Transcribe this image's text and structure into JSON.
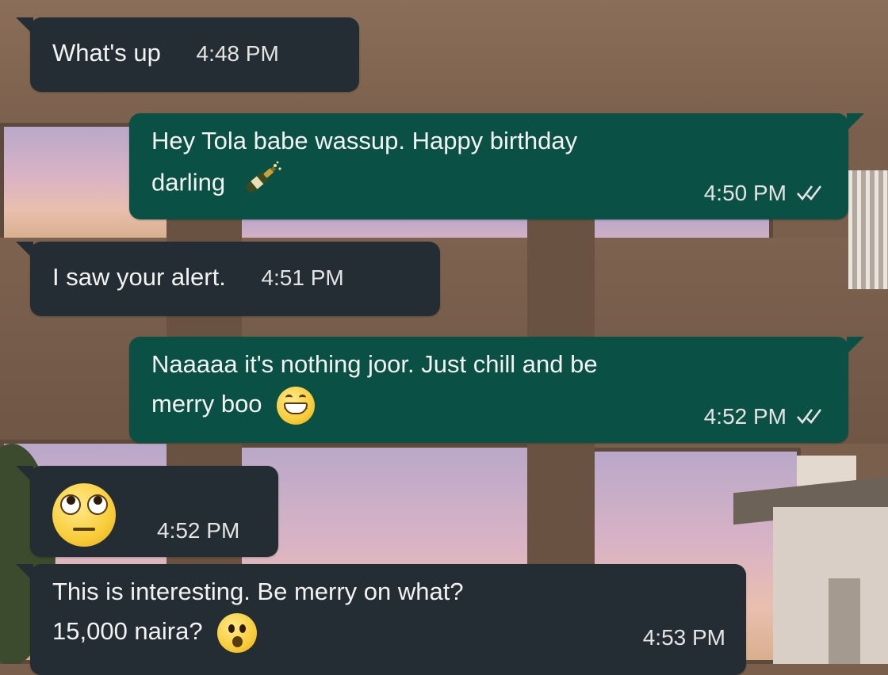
{
  "icons": {
    "champagne": "champagne-bottle-emoji",
    "grin": "grinning-face-emoji",
    "eye_roll": "face-with-rolling-eyes-emoji",
    "surprised": "face-with-open-mouth-emoji",
    "read_receipt": "double-check-icon"
  },
  "colors": {
    "incoming_bubble": "#232d33",
    "outgoing_bubble": "#0b5044",
    "text": "#f2f2f2"
  },
  "messages": [
    {
      "direction": "incoming",
      "text": "What's up",
      "time": "4:48 PM"
    },
    {
      "direction": "outgoing",
      "line1": "Hey Tola babe wassup. Happy birthday",
      "line2": "darling",
      "emoji": "champagne",
      "time": "4:50 PM",
      "status": "read"
    },
    {
      "direction": "incoming",
      "text": "I saw your alert.",
      "time": "4:51 PM"
    },
    {
      "direction": "outgoing",
      "line1": "Naaaaa it's nothing joor. Just chill and be",
      "line2": "merry boo",
      "emoji": "grin",
      "time": "4:52 PM",
      "status": "read"
    },
    {
      "direction": "incoming",
      "emoji": "eye_roll",
      "time": "4:52 PM"
    },
    {
      "direction": "incoming",
      "line1": "This is interesting.  Be merry on what?",
      "line2": "15,000 naira?",
      "emoji": "surprised",
      "time": "4:53 PM"
    }
  ]
}
